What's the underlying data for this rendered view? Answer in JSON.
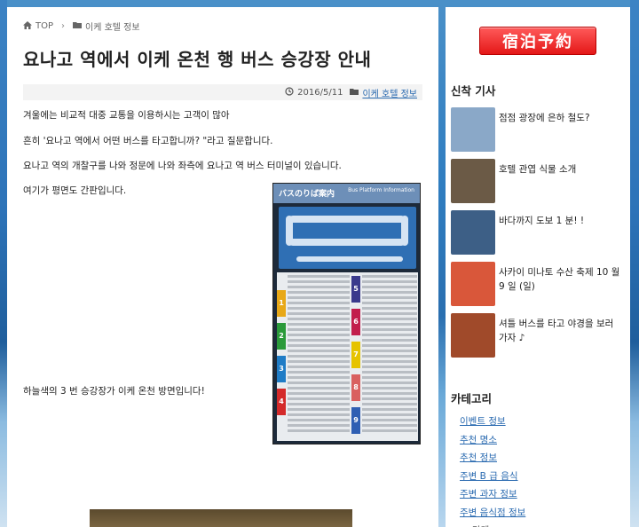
{
  "breadcrumb": {
    "home": "TOP",
    "category": "이케 호텔 정보"
  },
  "article": {
    "title": "요나고 역에서 이케 온천 행 버스 승강장 안내",
    "date": "2016/5/11",
    "category": "이케 호텔 정보",
    "paragraphs": [
      "겨울에는 비교적 대중 교통을 이용하시는 고객이 많아",
      "흔히 '요나고 역에서 어떤 버스를 타고합니까? \"라고 질문합니다.",
      "요나고 역의 개찰구를 나와 정문에 나와 좌측에 요나고 역 버스 터미널이 있습니다.",
      "여기가 평면도 간판입니다.",
      "하늘색의 3 번 승강장가 이케 온천 방면입니다!"
    ],
    "board": {
      "title_jp": "バスのりば案内",
      "title_en": "Bus Platform Information",
      "lanes_left": [
        "1",
        "2",
        "3",
        "4"
      ],
      "lanes_right": [
        "5",
        "6",
        "7",
        "8",
        "9"
      ],
      "lane_colors_left": [
        "#e8a817",
        "#2b9a3a",
        "#1f7cc6",
        "#d42a2a"
      ],
      "lane_colors_right": [
        "#3a3a8c",
        "#c21e4c",
        "#e6c300",
        "#d96060",
        "#2f5fb3"
      ]
    }
  },
  "sidebar": {
    "reserve_label": "宿泊予約",
    "recent_heading": "신착 기사",
    "recent_posts": [
      {
        "title": "점점 광장에 은하 철도?",
        "thumb_color": "#8aa8c8"
      },
      {
        "title": "호텔 관엽 식물 소개",
        "thumb_color": "#6b5a46"
      },
      {
        "title": "바다까지 도보 1 분! !",
        "thumb_color": "#3d5f86"
      },
      {
        "title": "사카이 미나토 수산 축제 10 월 9 일 (일)",
        "thumb_color": "#d9573a"
      },
      {
        "title": "셔틀 버스를 타고 야경을 보러 가자 ♪",
        "thumb_color": "#a04a2a"
      }
    ],
    "category_heading": "카테고리",
    "categories": [
      "이벤트 정보",
      "추천 명소",
      "추천 정보",
      "주변 B 급 음식",
      "주변 과자 정보",
      "주변 음식점 정보",
      "라멘"
    ]
  }
}
